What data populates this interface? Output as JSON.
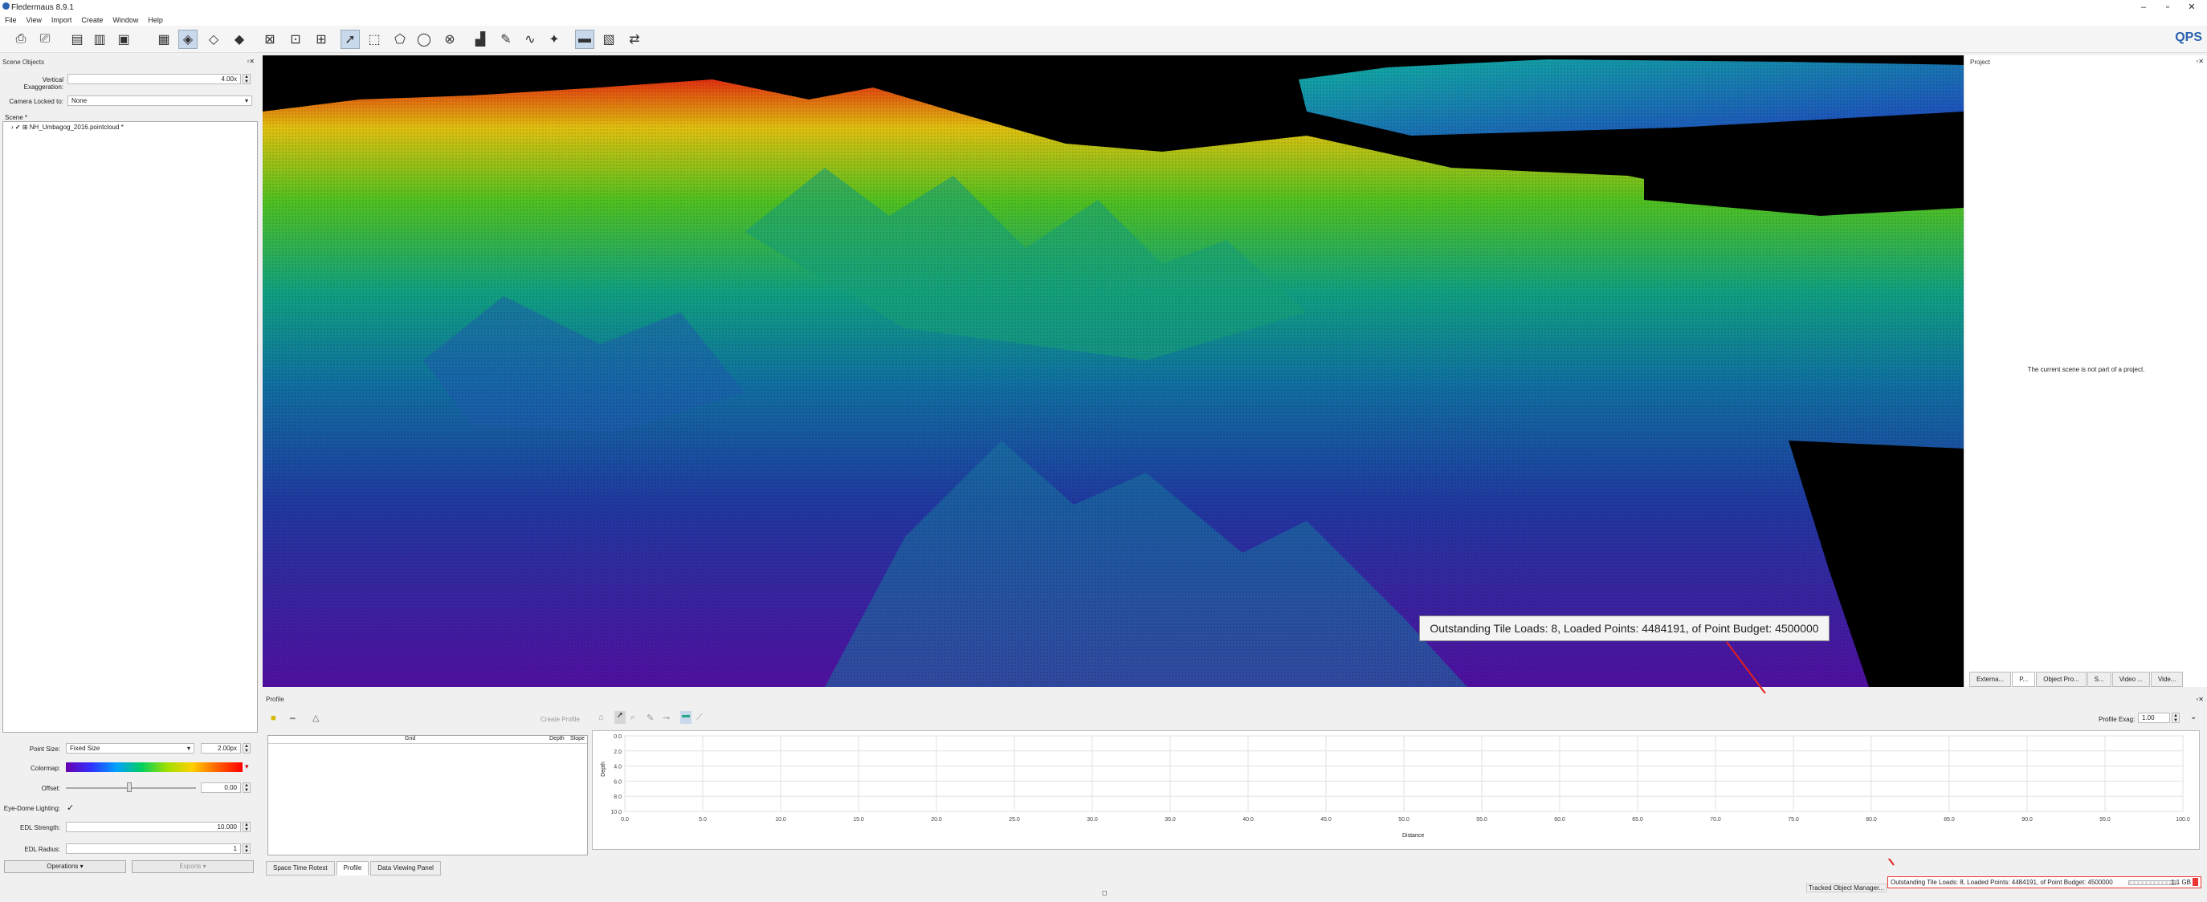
{
  "app": {
    "title": "Fledermaus 8.9.1",
    "brand": "QPS"
  },
  "menu": [
    "File",
    "View",
    "Import",
    "Create",
    "Window",
    "Help"
  ],
  "scene_objects": {
    "header": "Scene Objects",
    "vertical_exaggeration_label": "Vertical Exaggeration:",
    "vertical_exaggeration_value": "4.00x",
    "camera_locked_label": "Camera Locked to:",
    "camera_locked_value": "None",
    "scene_label": "Scene *",
    "tree_item": "NH_Umbagog_2016.pointcloud *"
  },
  "point_props": {
    "point_size_label": "Point Size:",
    "point_size_mode": "Fixed Size",
    "point_size_value": "2.00px",
    "colormap_label": "Colormap:",
    "offset_label": "Offset:",
    "offset_value": "0.00",
    "edl_label": "Eye-Dome Lighting:",
    "edl_strength_label": "EDL Strength:",
    "edl_strength_value": "10.000",
    "edl_radius_label": "EDL Radius:",
    "edl_radius_value": "1",
    "operations": "Operations",
    "exports": "Exports"
  },
  "viewport": {
    "tooltip": "Outstanding Tile Loads: 8, Loaded Points: 4484191, of Point Budget: 4500000"
  },
  "project": {
    "header": "Project",
    "message": "The current scene is not part of a project.",
    "tabs": [
      "Externa...",
      "P...",
      "Object Pro...",
      "S...",
      "Video ...",
      "Vide..."
    ]
  },
  "profile": {
    "header": "Profile",
    "create_profile": "Create Profile",
    "profile_exag_label": "Profile Exag:",
    "profile_exag_value": "1.00",
    "grid_col": "Grid",
    "depth_col": "Depth",
    "slope_col": "Slope",
    "y_label": "Depth",
    "x_label": "Distance",
    "y_ticks": [
      "0.0",
      "2.0",
      "4.0",
      "6.0",
      "8.0",
      "10.0"
    ],
    "x_ticks": [
      "0.0",
      "5.0",
      "10.0",
      "15.0",
      "20.0",
      "25.0",
      "30.0",
      "35.0",
      "40.0",
      "45.0",
      "50.0",
      "55.0",
      "60.0",
      "65.0",
      "70.0",
      "75.0",
      "80.0",
      "85.0",
      "90.0",
      "95.0",
      "100.0"
    ]
  },
  "bottom_tabs": [
    "Space Time Rotest",
    "Profile",
    "Data Viewing Panel"
  ],
  "status": {
    "tracked": "Tracked Object Manager...",
    "message": "Outstanding Tile Loads: 8, Loaded Points: 4484191, of Point Budget: 4500000",
    "progress_label": "1.1 GB"
  },
  "colors": {
    "accent": "#2a62b0",
    "annotation": "#e02020"
  }
}
